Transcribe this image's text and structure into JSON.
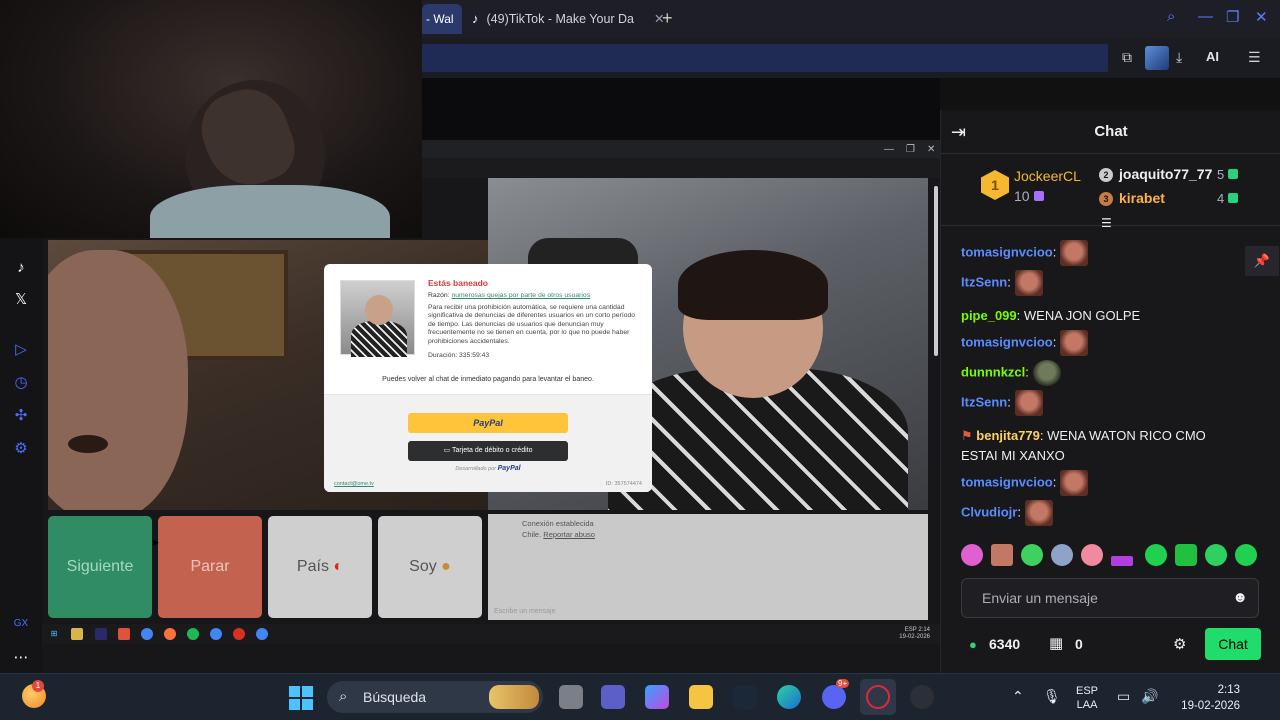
{
  "browser": {
    "active_tab_label": "- Wal",
    "tab": {
      "label": "(49)TikTok - Make Your Da",
      "icon": "tiktok-icon"
    },
    "ai_label": "AI"
  },
  "modal": {
    "title": "Estás baneado",
    "reason_label": "Razón:",
    "reason_link": "numerosas quejas por parte de otros usuarios",
    "body": "Para recibir una prohibición automática, se requiere una cantidad significativa de denuncias de diferentes usuarios en un corto período de tiempo. Las denuncias de usuarios que denuncian muy frecuentemente no se tienen en cuenta, por lo que no puede haber prohibiciones accidentales.",
    "duration": "Duración: 335:59:43",
    "pay_text": "Puedes volver al chat de inmediato pagando para levantar el baneo.",
    "paypal_label": "PayPal",
    "card_label": "Tarjeta de débito o crédito",
    "powered_prefix": "Desarrollado por",
    "powered_brand": "PayPal",
    "footer_left": "contact@ome.tv",
    "footer_right": "ID: 357574474"
  },
  "controls": {
    "next": "Siguiente",
    "stop": "Parar",
    "country": "País",
    "soy": "Soy"
  },
  "side_chat": {
    "connection": "Conexión establecida",
    "country_prefix": "Chile.",
    "country_link": "Reportar abuso",
    "placeholder": "Escribe un mensaje"
  },
  "inner_taskbar": {
    "lang": "ESP",
    "time": "2:14",
    "date": "19-02-2026"
  },
  "chat": {
    "title": "Chat",
    "leaderboard": {
      "first": {
        "rank": "1",
        "name": "JockeerCL",
        "value": "10"
      },
      "second": {
        "rank": "2",
        "name": "joaquito77_77",
        "value": "5"
      },
      "third": {
        "rank": "3",
        "name": "kirabet",
        "value": "4"
      }
    },
    "messages": [
      {
        "user": "tomasignvcioo",
        "color": "#5b8cff",
        "text": ""
      },
      {
        "user": "ItzSenn",
        "color": "#5b8cff",
        "text": ""
      },
      {
        "user": "pipe_099",
        "color": "#7cfc00",
        "text": "WENA JON GOLPE"
      },
      {
        "user": "tomasignvcioo",
        "color": "#5b8cff",
        "text": ""
      },
      {
        "user": "dunnnkzcl",
        "color": "#7cfc00",
        "text": ""
      },
      {
        "user": "ItzSenn",
        "color": "#5b8cff",
        "text": ""
      },
      {
        "user": "benjita779",
        "color": "#ffd35b",
        "text": "WENA WATON RICO CMO",
        "text2": "ESTAI MI XANXO"
      },
      {
        "user": "tomasignvcioo",
        "color": "#5b8cff",
        "text": ""
      },
      {
        "user": "Clvudiojr",
        "color": "#5b8cff",
        "text": ""
      }
    ],
    "input_placeholder": "Enviar un mensaje",
    "points": "6340",
    "drops": "0",
    "send_label": "Chat"
  },
  "taskbar": {
    "search_label": "Búsqueda",
    "weather_badge": "1",
    "discord_badge": "9+",
    "lang_top": "ESP",
    "lang_bottom": "LAA",
    "time": "2:13",
    "date": "19-02-2026"
  }
}
